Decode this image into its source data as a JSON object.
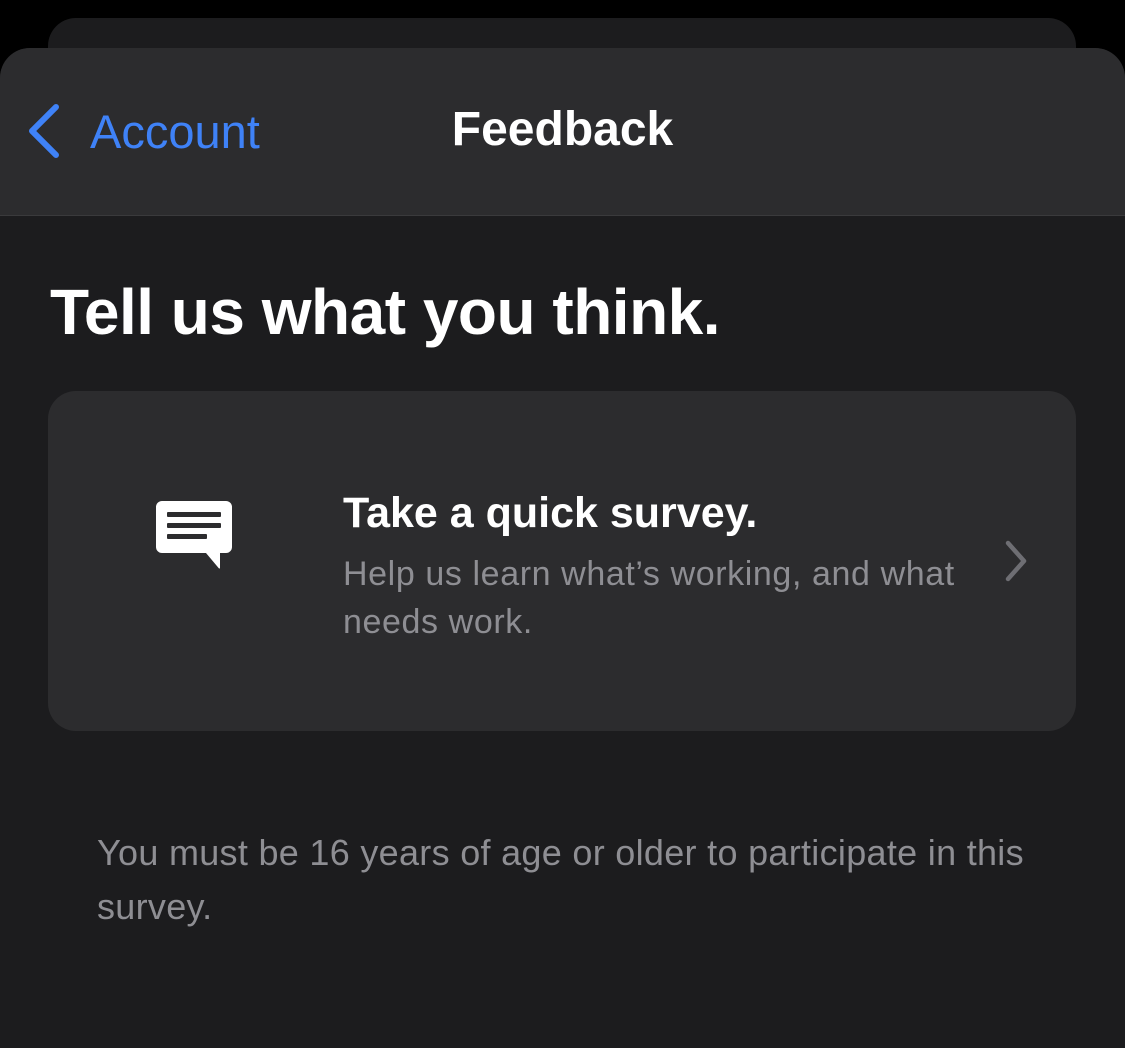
{
  "navbar": {
    "back_label": "Account",
    "title": "Feedback"
  },
  "main": {
    "headline": "Tell us what you think.",
    "survey_card": {
      "icon": "message-bubble-icon",
      "title": "Take a quick survey.",
      "subtitle": "Help us learn what’s working, and what needs work."
    },
    "disclaimer": "You must be 16 years of age or older to participate in this survey."
  },
  "colors": {
    "accent": "#3f82f7",
    "background": "#1c1c1e",
    "card": "#2c2c2e",
    "secondary_text": "#8e8e93"
  }
}
